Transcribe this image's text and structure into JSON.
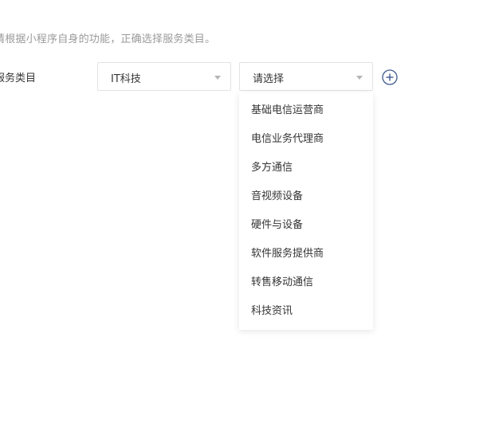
{
  "hint_text": "请根据小程序自身的功能，正确选择服务类目。",
  "field_label": "服务类目",
  "primary_select": {
    "value": "IT科技"
  },
  "secondary_select": {
    "placeholder": "请选择"
  },
  "add_button": {
    "icon": "plus-circle-icon",
    "color": "#3e5a8e"
  },
  "dropdown": {
    "options": [
      "基础电信运营商",
      "电信业务代理商",
      "多方通信",
      "音视频设备",
      "硬件与设备",
      "软件服务提供商",
      "转售移动通信",
      "科技资讯"
    ]
  }
}
